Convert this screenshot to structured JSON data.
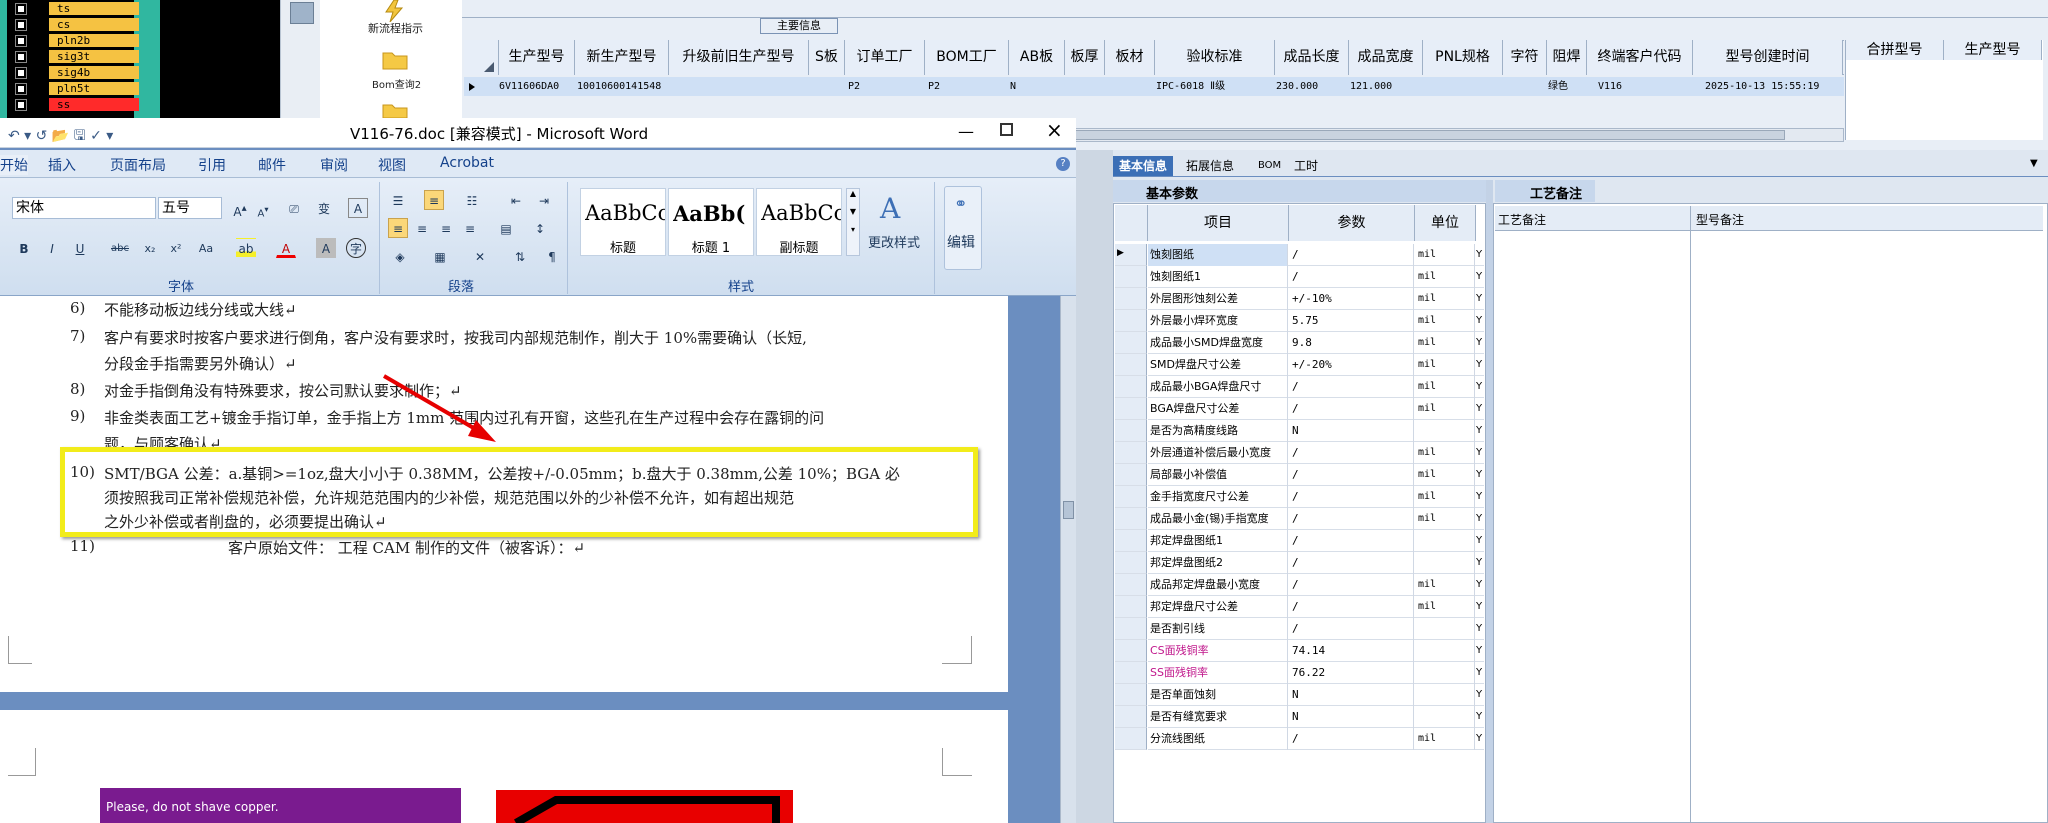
{
  "layers": [
    {
      "name": "ts",
      "red": false
    },
    {
      "name": "cs",
      "red": false
    },
    {
      "name": "pln2b",
      "red": false
    },
    {
      "name": "sig3t",
      "red": false
    },
    {
      "name": "sig4b",
      "red": false
    },
    {
      "name": "pln5t",
      "red": false
    },
    {
      "name": "ss",
      "red": true
    }
  ],
  "launcher": {
    "item1": "新流程指示",
    "item2": "Bom查询2"
  },
  "top_grid": {
    "group_label": "主要信息",
    "columns": [
      "生产型号",
      "新生产型号",
      "升级前旧生产型号",
      "S板",
      "订单工厂",
      "BOM工厂",
      "AB板",
      "板厚",
      "板材",
      "验收标准",
      "成品长度",
      "成品宽度",
      "PNL规格",
      "字符",
      "阻焊",
      "终端客户代码",
      "型号创建时间"
    ],
    "row": {
      "c1": "6V11606DA0",
      "c2": "10010600141548",
      "c3": "",
      "c4": "",
      "c5": "P2",
      "c6": "P2",
      "c7": "N",
      "c8": "",
      "c9": "",
      "c10": "IPC-6018 Ⅱ级",
      "c11": "230.000",
      "c12": "121.000",
      "c13": "",
      "c14": "",
      "c15": "绿色",
      "c16": "V116",
      "c17": "2025-10-13 15:55:19"
    },
    "sub_columns": [
      "合拼型号",
      "生产型号"
    ]
  },
  "word": {
    "title": "V116-76.doc [兼容模式] - Microsoft Word",
    "tabs": [
      "开始",
      "插入",
      "页面布局",
      "引用",
      "邮件",
      "审阅",
      "视图",
      "Acrobat"
    ],
    "font_name": "宋体",
    "font_size": "五号",
    "groups": {
      "font": "字体",
      "paragraph": "段落",
      "styles": "样式"
    },
    "styles": [
      {
        "sample": "AaBbCc",
        "label": "标题"
      },
      {
        "sample": "AaBb(",
        "label": "标题 1"
      },
      {
        "sample": "AaBbCc",
        "label": "副标题"
      }
    ],
    "change_styles": "更改样式",
    "edit": "编辑",
    "doc_lines": [
      {
        "num": "6)",
        "text": "不能移动板边线分线或大线↵"
      },
      {
        "num": "7)",
        "text": "客户有要求时按客户要求进行倒角，客户没有要求时，按我司内部规范制作，削大于 10%需要确认（长短,"
      },
      {
        "num": "",
        "text": "分段金手指需要另外确认）↵"
      },
      {
        "num": "8)",
        "text": "对金手指倒角没有特殊要求，按公司默认要求制作；↵"
      },
      {
        "num": "9)",
        "text": "非金类表面工艺+镀金手指订单，金手指上方 1mm 范围内过孔有开窗，这些孔在生产过程中会存在露铜的问"
      },
      {
        "num": "",
        "text": "题，与顾客确认↵"
      },
      {
        "num": "10)",
        "text": "SMT/BGA 公差：a.基铜>=1oz,盘大小小于 0.38MM，公差按+/-0.05mm；b.盘大于 0.38mm,公差 10%；BGA 必"
      },
      {
        "num": "",
        "text": "须按照我司正常补偿规范补偿，允许规范范围内的少补偿，规范范围以外的少补偿不允许，如有超出规范"
      },
      {
        "num": "",
        "text": "之外少补偿或者削盘的，必须要提出确认↵"
      },
      {
        "num": "11)",
        "text": "客户原始文件：                    工程 CAM 制作的文件（被客诉）：↵"
      }
    ],
    "page2_note": "Please, do not shave copper."
  },
  "right_panel": {
    "tabs": [
      "基本信息",
      "拓展信息",
      "BOM",
      "工时"
    ],
    "base_params_tab": "基本参数",
    "headers": {
      "item": "项目",
      "param": "参数",
      "unit": "单位"
    },
    "process_tab": "工艺备注",
    "process_headers": [
      "工艺备注",
      "型号备注"
    ],
    "rows": [
      {
        "name": "蚀刻图纸",
        "val": "/",
        "unit": "mil",
        "flag": "Y",
        "pink": false
      },
      {
        "name": "蚀刻图纸1",
        "val": "/",
        "unit": "mil",
        "flag": "Y",
        "pink": false
      },
      {
        "name": "外层图形蚀刻公差",
        "val": "+/-10%",
        "unit": "mil",
        "flag": "Y",
        "pink": false
      },
      {
        "name": "外层最小焊环宽度",
        "val": "5.75",
        "unit": "mil",
        "flag": "Y",
        "pink": false
      },
      {
        "name": "成品最小SMD焊盘宽度",
        "val": "9.8",
        "unit": "mil",
        "flag": "Y",
        "pink": false
      },
      {
        "name": "SMD焊盘尺寸公差",
        "val": "+/-20%",
        "unit": "mil",
        "flag": "Y",
        "pink": false
      },
      {
        "name": "成品最小BGA焊盘尺寸",
        "val": "/",
        "unit": "mil",
        "flag": "Y",
        "pink": false
      },
      {
        "name": "BGA焊盘尺寸公差",
        "val": "/",
        "unit": "mil",
        "flag": "Y",
        "pink": false
      },
      {
        "name": "是否为高精度线路",
        "val": "N",
        "unit": "",
        "flag": "Y",
        "pink": false
      },
      {
        "name": "外层通道补偿后最小宽度",
        "val": "/",
        "unit": "mil",
        "flag": "Y",
        "pink": false
      },
      {
        "name": "局部最小补偿值",
        "val": "/",
        "unit": "mil",
        "flag": "Y",
        "pink": false
      },
      {
        "name": "金手指宽度尺寸公差",
        "val": "/",
        "unit": "mil",
        "flag": "Y",
        "pink": false
      },
      {
        "name": "成品最小金(锡)手指宽度",
        "val": "/",
        "unit": "mil",
        "flag": "Y",
        "pink": false
      },
      {
        "name": "邦定焊盘图纸1",
        "val": "/",
        "unit": "",
        "flag": "Y",
        "pink": false
      },
      {
        "name": "邦定焊盘图纸2",
        "val": "/",
        "unit": "",
        "flag": "Y",
        "pink": false
      },
      {
        "name": "成品邦定焊盘最小宽度",
        "val": "/",
        "unit": "mil",
        "flag": "Y",
        "pink": false
      },
      {
        "name": "邦定焊盘尺寸公差",
        "val": "/",
        "unit": "mil",
        "flag": "Y",
        "pink": false
      },
      {
        "name": "是否割引线",
        "val": "/",
        "unit": "",
        "flag": "Y",
        "pink": false
      },
      {
        "name": "CS面残铜率",
        "val": "74.14",
        "unit": "",
        "flag": "Y",
        "pink": true
      },
      {
        "name": "SS面残铜率",
        "val": "76.22",
        "unit": "",
        "flag": "Y",
        "pink": true
      },
      {
        "name": "是否单面蚀刻",
        "val": "N",
        "unit": "",
        "flag": "Y",
        "pink": false
      },
      {
        "name": "是否有缝宽要求",
        "val": "N",
        "unit": "",
        "flag": "Y",
        "pink": false
      },
      {
        "name": "分流线图纸",
        "val": "/",
        "unit": "mil",
        "flag": "Y",
        "pink": false
      }
    ]
  },
  "colors": {
    "highlight": "#f2ec1a",
    "pink_text": "#c0168b",
    "ribbon_blue": "#15428b"
  }
}
